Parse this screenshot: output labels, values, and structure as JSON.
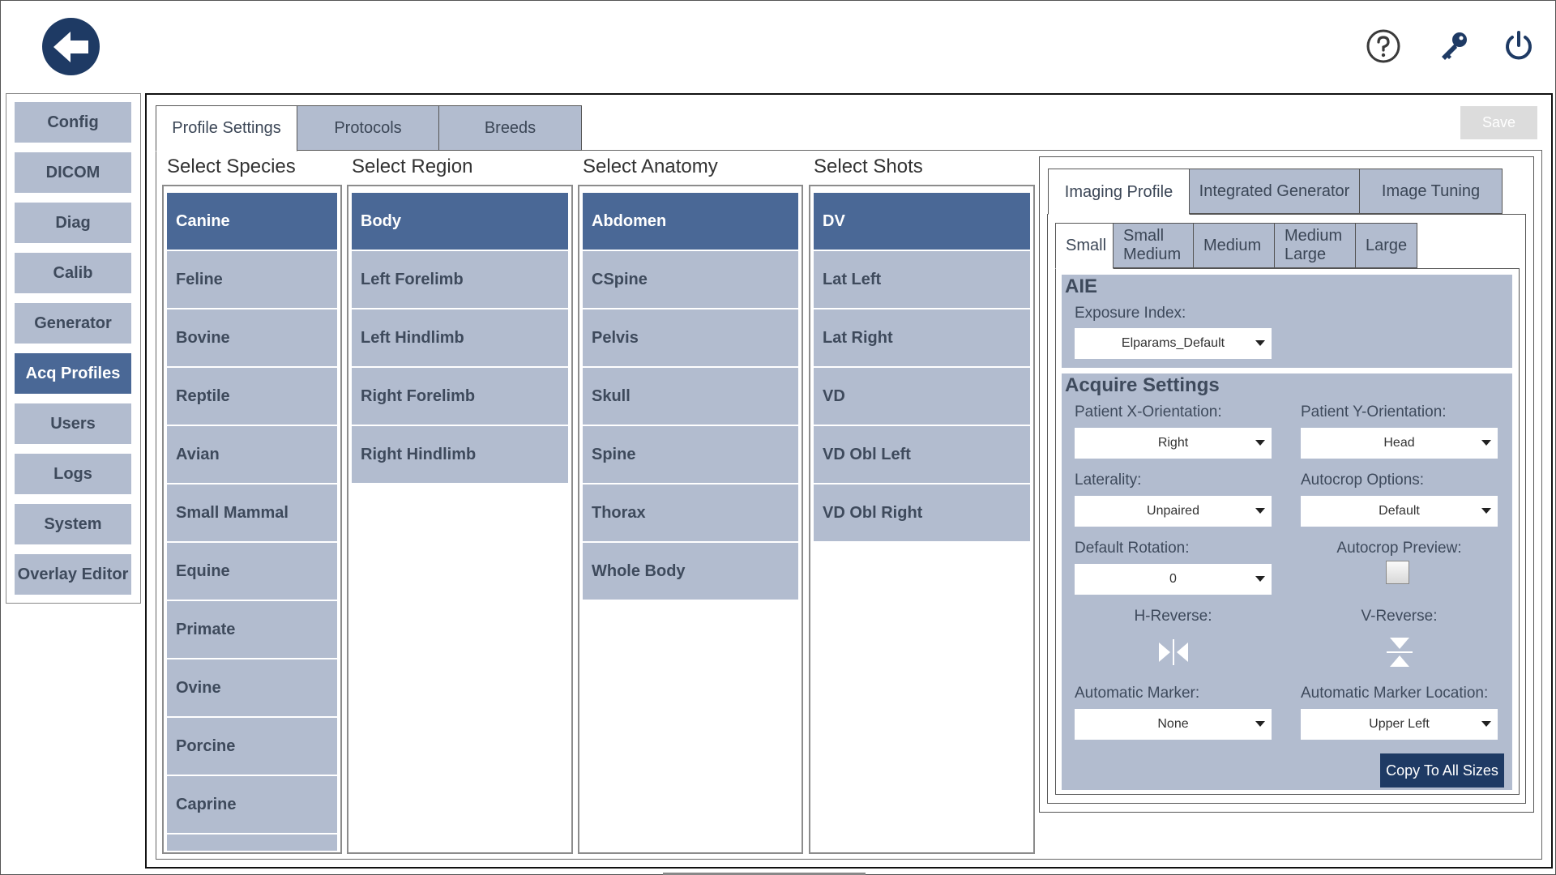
{
  "nav": {
    "items": [
      {
        "label": "Config"
      },
      {
        "label": "DICOM"
      },
      {
        "label": "Diag"
      },
      {
        "label": "Calib"
      },
      {
        "label": "Generator"
      },
      {
        "label": "Acq Profiles"
      },
      {
        "label": "Users"
      },
      {
        "label": "Logs"
      },
      {
        "label": "System"
      },
      {
        "label": "Overlay Editor"
      }
    ],
    "active": "Acq Profiles"
  },
  "tabs": [
    {
      "label": "Profile Settings"
    },
    {
      "label": "Protocols"
    },
    {
      "label": "Breeds"
    }
  ],
  "save_label": "Save",
  "columns": {
    "species": {
      "title": "Select Species",
      "items": [
        "Canine",
        "Feline",
        "Bovine",
        "Reptile",
        "Avian",
        "Small Mammal",
        "Equine",
        "Primate",
        "Ovine",
        "Porcine",
        "Caprine"
      ]
    },
    "region": {
      "title": "Select Region",
      "items": [
        "Body",
        "Left Forelimb",
        "Left Hindlimb",
        "Right Forelimb",
        "Right Hindlimb"
      ]
    },
    "anatomy": {
      "title": "Select Anatomy",
      "items": [
        "Abdomen",
        "CSpine",
        "Pelvis",
        "Skull",
        "Spine",
        "Thorax",
        "Whole Body"
      ]
    },
    "shots": {
      "title": "Select Shots",
      "items": [
        "DV",
        "Lat Left",
        "Lat Right",
        "VD",
        "VD Obl Left",
        "VD Obl Right"
      ]
    }
  },
  "settings": {
    "tabs": [
      {
        "label": "Imaging Profile"
      },
      {
        "label": "Integrated Generator"
      },
      {
        "label": "Image Tuning"
      }
    ],
    "sizes": [
      {
        "line1": "Small",
        "line2": ""
      },
      {
        "line1": "Small",
        "line2": "Medium"
      },
      {
        "line1": "Medium",
        "line2": ""
      },
      {
        "line1": "Medium",
        "line2": "Large"
      },
      {
        "line1": "Large",
        "line2": ""
      }
    ],
    "aie": {
      "title": "AIE",
      "exposure_index_label": "Exposure Index:",
      "exposure_index_value": "Elparams_Default"
    },
    "acquire": {
      "title": "Acquire Settings",
      "x_orientation_label": "Patient X-Orientation:",
      "x_orientation_value": "Right",
      "y_orientation_label": "Patient Y-Orientation:",
      "y_orientation_value": "Head",
      "laterality_label": "Laterality:",
      "laterality_value": "Unpaired",
      "autocrop_options_label": "Autocrop Options:",
      "autocrop_options_value": "Default",
      "default_rotation_label": "Default Rotation:",
      "default_rotation_value": "0",
      "autocrop_preview_label": "Autocrop Preview:",
      "h_reverse_label": "H-Reverse:",
      "v_reverse_label": "V-Reverse:",
      "auto_marker_label": "Automatic Marker:",
      "auto_marker_value": "None",
      "auto_marker_location_label": "Automatic Marker Location:",
      "auto_marker_location_value": "Upper Left"
    },
    "copy_label": "Copy To All Sizes"
  },
  "colors": {
    "dark_navy": "#1e3a64",
    "selected": "#4a6896",
    "item_bg": "#b2bccf"
  }
}
